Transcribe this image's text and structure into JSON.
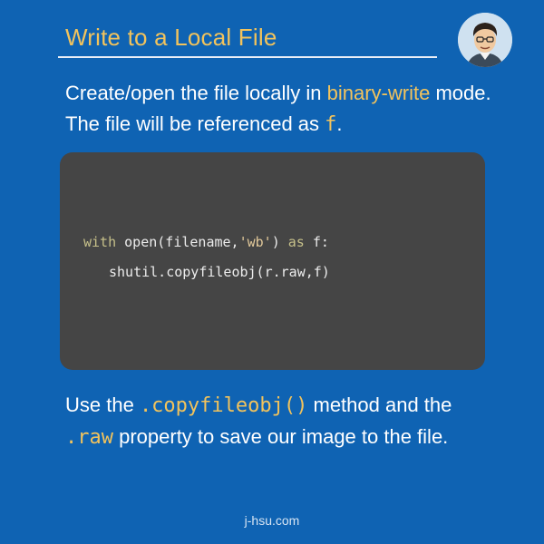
{
  "header": {
    "title": "Write to a Local File",
    "avatar_icon": "cartoon-avatar-icon"
  },
  "intro": {
    "part1": "Create/open the file locally in ",
    "highlight": "binary-write",
    "part2": " mode. The file will be referenced as ",
    "var": "f",
    "part3": "."
  },
  "code": {
    "line1": {
      "kw1": "with",
      "fn": " open(filename,",
      "str": "'wb'",
      "mid": ") ",
      "kw2": "as",
      "end": " f:"
    },
    "line2": "shutil.copyfileobj(r.raw,f)"
  },
  "outro": {
    "part1": "Use the ",
    "method": ".copyfileobj()",
    "part2": " method and the ",
    "prop": ".raw",
    "part3": " property to save our image to the file."
  },
  "footer": {
    "site": "j-hsu.com"
  },
  "colors": {
    "background": "#0f63b3",
    "accent": "#f2c35c",
    "code_bg": "#454545"
  }
}
